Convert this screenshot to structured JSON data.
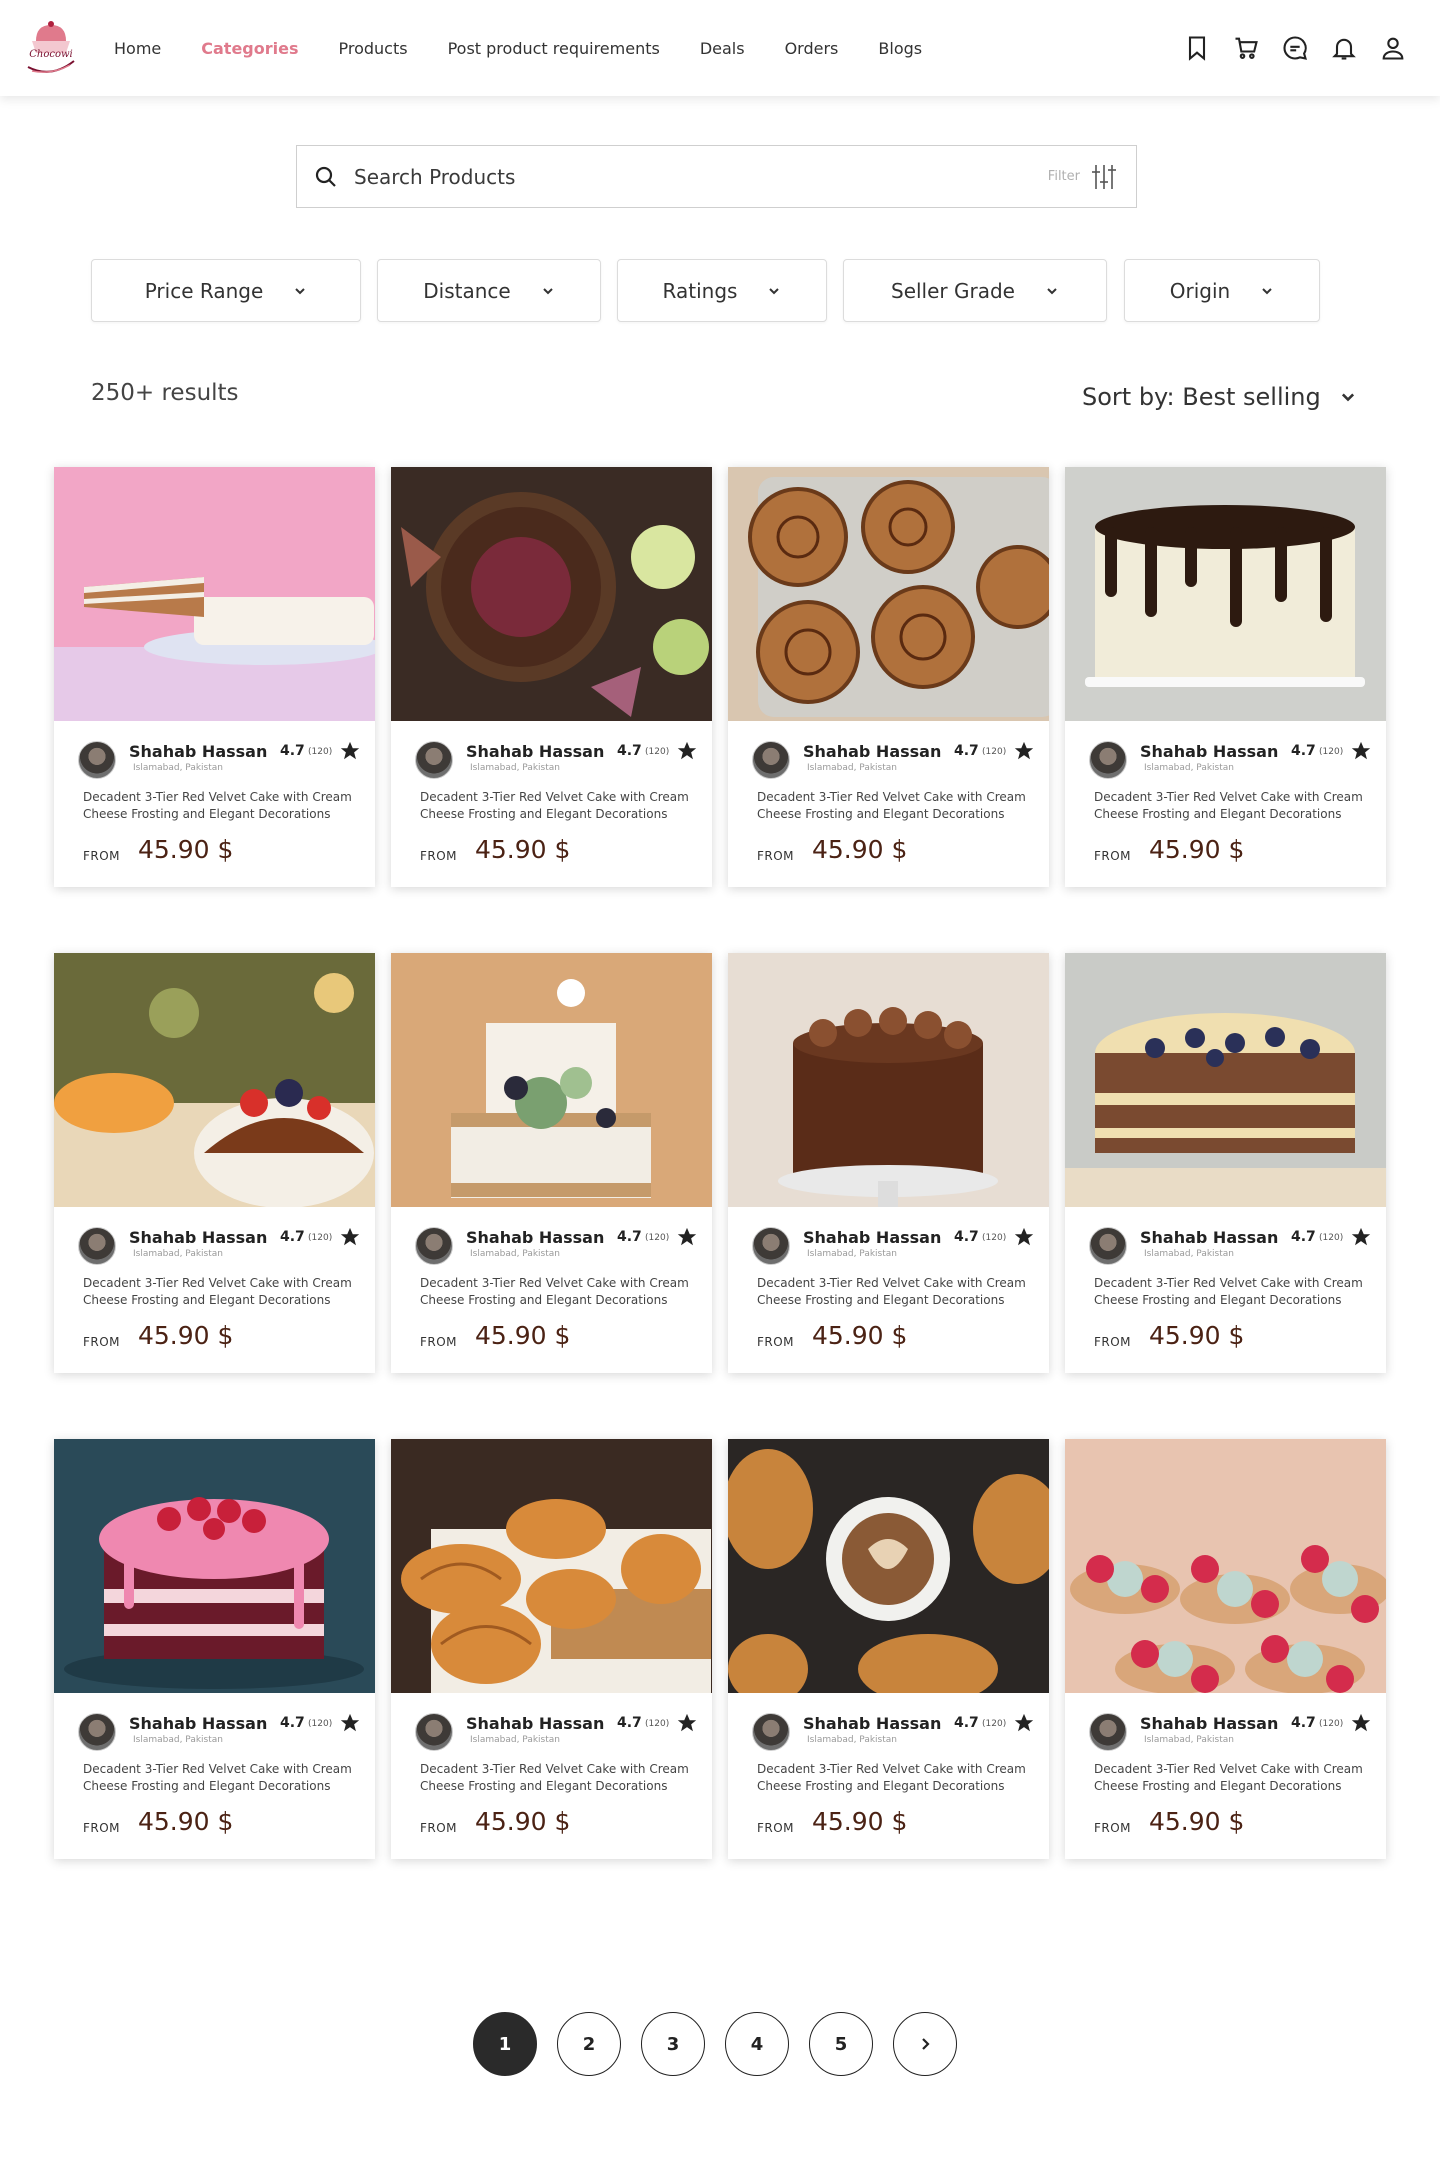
{
  "brand": {
    "name": "Chocowi",
    "accent": "#e07a8c",
    "price_color": "#4b2214"
  },
  "nav": [
    {
      "label": "Home",
      "active": false
    },
    {
      "label": "Categories",
      "active": true
    },
    {
      "label": "Products",
      "active": false
    },
    {
      "label": "Post product requirements",
      "active": false
    },
    {
      "label": "Deals",
      "active": false
    },
    {
      "label": "Orders",
      "active": false
    },
    {
      "label": "Blogs",
      "active": false
    }
  ],
  "header_icons": [
    "bookmark-icon",
    "cart-icon",
    "chat-icon",
    "bell-icon",
    "user-icon"
  ],
  "search": {
    "placeholder": "Search Products",
    "filter_label": "Filter"
  },
  "filters": [
    {
      "label": "Price Range"
    },
    {
      "label": "Distance"
    },
    {
      "label": "Ratings"
    },
    {
      "label": "Seller Grade"
    },
    {
      "label": "Origin"
    }
  ],
  "results": {
    "count": "250+ results",
    "sort": "Sort by: Best selling"
  },
  "products": [
    {
      "seller": "Shahab Hassan",
      "location": "Islamabad, Pakistan",
      "rating": "4.7",
      "rating_count": "(120)",
      "description": "Decadent 3-Tier Red Velvet Cake with Cream Cheese Frosting and Elegant Decorations",
      "from": "FROM",
      "price": "45.90 $",
      "image": "slice-of-carrot-cake-on-pink"
    },
    {
      "seller": "Shahab Hassan",
      "location": "Islamabad, Pakistan",
      "rating": "4.7",
      "rating_count": "(120)",
      "description": "Decadent 3-Tier Red Velvet Cake with Cream Cheese Frosting and Elegant Decorations",
      "from": "FROM",
      "price": "45.90 $",
      "image": "chocolate-tart-with-apples"
    },
    {
      "seller": "Shahab Hassan",
      "location": "Islamabad, Pakistan",
      "rating": "4.7",
      "rating_count": "(120)",
      "description": "Decadent 3-Tier Red Velvet Cake with Cream Cheese Frosting and Elegant Decorations",
      "from": "FROM",
      "price": "45.90 $",
      "image": "cinnamon-rolls-in-dish"
    },
    {
      "seller": "Shahab Hassan",
      "location": "Islamabad, Pakistan",
      "rating": "4.7",
      "rating_count": "(120)",
      "description": "Decadent 3-Tier Red Velvet Cake with Cream Cheese Frosting and Elegant Decorations",
      "from": "FROM",
      "price": "45.90 $",
      "image": "white-cake-chocolate-drip"
    },
    {
      "seller": "Shahab Hassan",
      "location": "Islamabad, Pakistan",
      "rating": "4.7",
      "rating_count": "(120)",
      "description": "Decadent 3-Tier Red Velvet Cake with Cream Cheese Frosting and Elegant Decorations",
      "from": "FROM",
      "price": "45.90 $",
      "image": "fruit-cake-party-table"
    },
    {
      "seller": "Shahab Hassan",
      "location": "Islamabad, Pakistan",
      "rating": "4.7",
      "rating_count": "(120)",
      "description": "Decadent 3-Tier Red Velvet Cake with Cream Cheese Frosting and Elegant Decorations",
      "from": "FROM",
      "price": "45.90 $",
      "image": "two-tier-naked-cake-succulents"
    },
    {
      "seller": "Shahab Hassan",
      "location": "Islamabad, Pakistan",
      "rating": "4.7",
      "rating_count": "(120)",
      "description": "Decadent 3-Tier Red Velvet Cake with Cream Cheese Frosting and Elegant Decorations",
      "from": "FROM",
      "price": "45.90 $",
      "image": "chocolate-drip-cake-stand"
    },
    {
      "seller": "Shahab Hassan",
      "location": "Islamabad, Pakistan",
      "rating": "4.7",
      "rating_count": "(120)",
      "description": "Decadent 3-Tier Red Velvet Cake with Cream Cheese Frosting and Elegant Decorations",
      "from": "FROM",
      "price": "45.90 $",
      "image": "layer-cake-blueberries"
    },
    {
      "seller": "Shahab Hassan",
      "location": "Islamabad, Pakistan",
      "rating": "4.7",
      "rating_count": "(120)",
      "description": "Decadent 3-Tier Red Velvet Cake with Cream Cheese Frosting and Elegant Decorations",
      "from": "FROM",
      "price": "45.90 $",
      "image": "pink-raspberry-cake"
    },
    {
      "seller": "Shahab Hassan",
      "location": "Islamabad, Pakistan",
      "rating": "4.7",
      "rating_count": "(120)",
      "description": "Decadent 3-Tier Red Velvet Cake with Cream Cheese Frosting and Elegant Decorations",
      "from": "FROM",
      "price": "45.90 $",
      "image": "croissants-on-board"
    },
    {
      "seller": "Shahab Hassan",
      "location": "Islamabad, Pakistan",
      "rating": "4.7",
      "rating_count": "(120)",
      "description": "Decadent 3-Tier Red Velvet Cake with Cream Cheese Frosting and Elegant Decorations",
      "from": "FROM",
      "price": "45.90 $",
      "image": "coffee-and-croissants"
    },
    {
      "seller": "Shahab Hassan",
      "location": "Islamabad, Pakistan",
      "rating": "4.7",
      "rating_count": "(120)",
      "description": "Decadent 3-Tier Red Velvet Cake with Cream Cheese Frosting and Elegant Decorations",
      "from": "FROM",
      "price": "45.90 $",
      "image": "raspberry-tartlets"
    }
  ],
  "pagination": {
    "pages": [
      "1",
      "2",
      "3",
      "4",
      "5"
    ],
    "current": "1",
    "next_icon": "chevron-right-icon"
  }
}
